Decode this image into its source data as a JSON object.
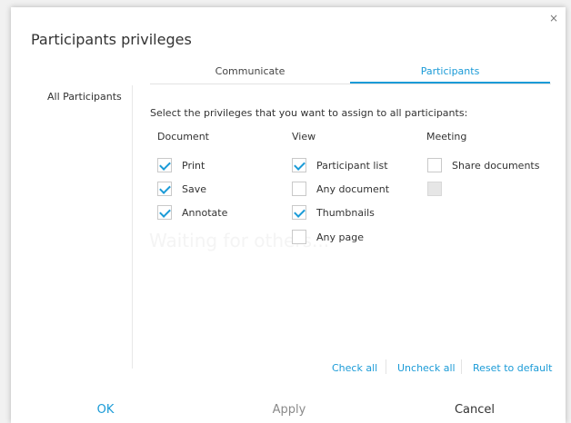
{
  "dialog": {
    "title": "Participants privileges",
    "close_glyph": "×"
  },
  "tabs": [
    {
      "label": "Communicate",
      "active": false
    },
    {
      "label": "Participants",
      "active": true
    }
  ],
  "sidebar": {
    "items": [
      {
        "label": "All Participants"
      }
    ]
  },
  "main": {
    "instruction": "Select the privileges that you want to assign to all participants:",
    "ghost_text": "Waiting for others..."
  },
  "columns": [
    {
      "heading": "Document",
      "options": [
        {
          "label": "Print",
          "checked": true
        },
        {
          "label": "Save",
          "checked": true
        },
        {
          "label": "Annotate",
          "checked": true
        }
      ]
    },
    {
      "heading": "View",
      "options": [
        {
          "label": "Participant list",
          "checked": true
        },
        {
          "label": "Any document",
          "checked": false
        },
        {
          "label": "Thumbnails",
          "checked": true
        },
        {
          "label": "Any page",
          "checked": false
        }
      ]
    },
    {
      "heading": "Meeting",
      "options": [
        {
          "label": "Share documents",
          "checked": false
        },
        {
          "label": "",
          "checked": false,
          "disabled": true
        }
      ]
    }
  ],
  "links": {
    "check_all": "Check all",
    "uncheck_all": "Uncheck all",
    "reset": "Reset to default"
  },
  "footer": {
    "ok": "OK",
    "apply": "Apply",
    "cancel": "Cancel"
  },
  "colors": {
    "accent": "#1b9bd7",
    "disabled_text": "#8a8a8a"
  }
}
